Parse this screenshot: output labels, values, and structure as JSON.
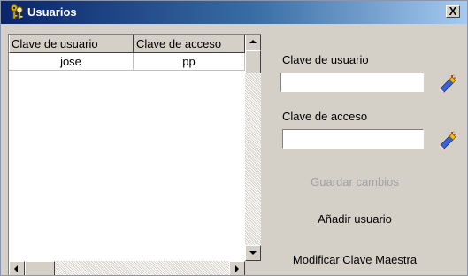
{
  "window": {
    "title": "Usuarios",
    "close_label": "X"
  },
  "table": {
    "columns": [
      "Clave de usuario",
      "Clave de acceso"
    ],
    "rows": [
      [
        "jose",
        "pp"
      ]
    ]
  },
  "form": {
    "user_label": "Clave de usuario",
    "user_value": "",
    "password_label": "Clave de acceso",
    "password_value": ""
  },
  "actions": {
    "save_label": "Guardar cambios",
    "add_user_label": "Añadir usuario",
    "master_key_label": "Modificar Clave Maestra"
  }
}
